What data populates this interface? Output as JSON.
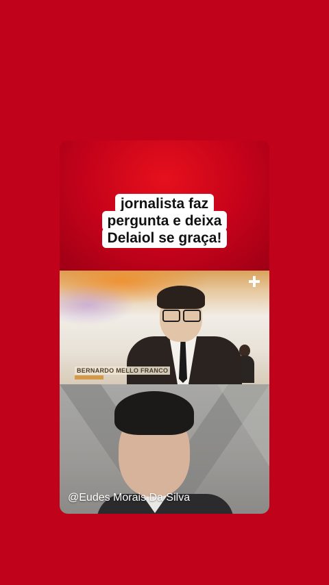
{
  "colors": {
    "background": "#c0021a",
    "caption_bg": "#ffffff",
    "caption_text": "#111111"
  },
  "caption": {
    "lines": [
      "jornalista faz",
      "pergunta e deixa",
      "Delaiol se graça!"
    ]
  },
  "video_top": {
    "lower_third_name": "BERNARDO MELLO FRANCO",
    "channel_icon": "tv-channel-cross-icon"
  },
  "video_bottom": {
    "watermark": "@Eudes Morais Da Silva"
  }
}
